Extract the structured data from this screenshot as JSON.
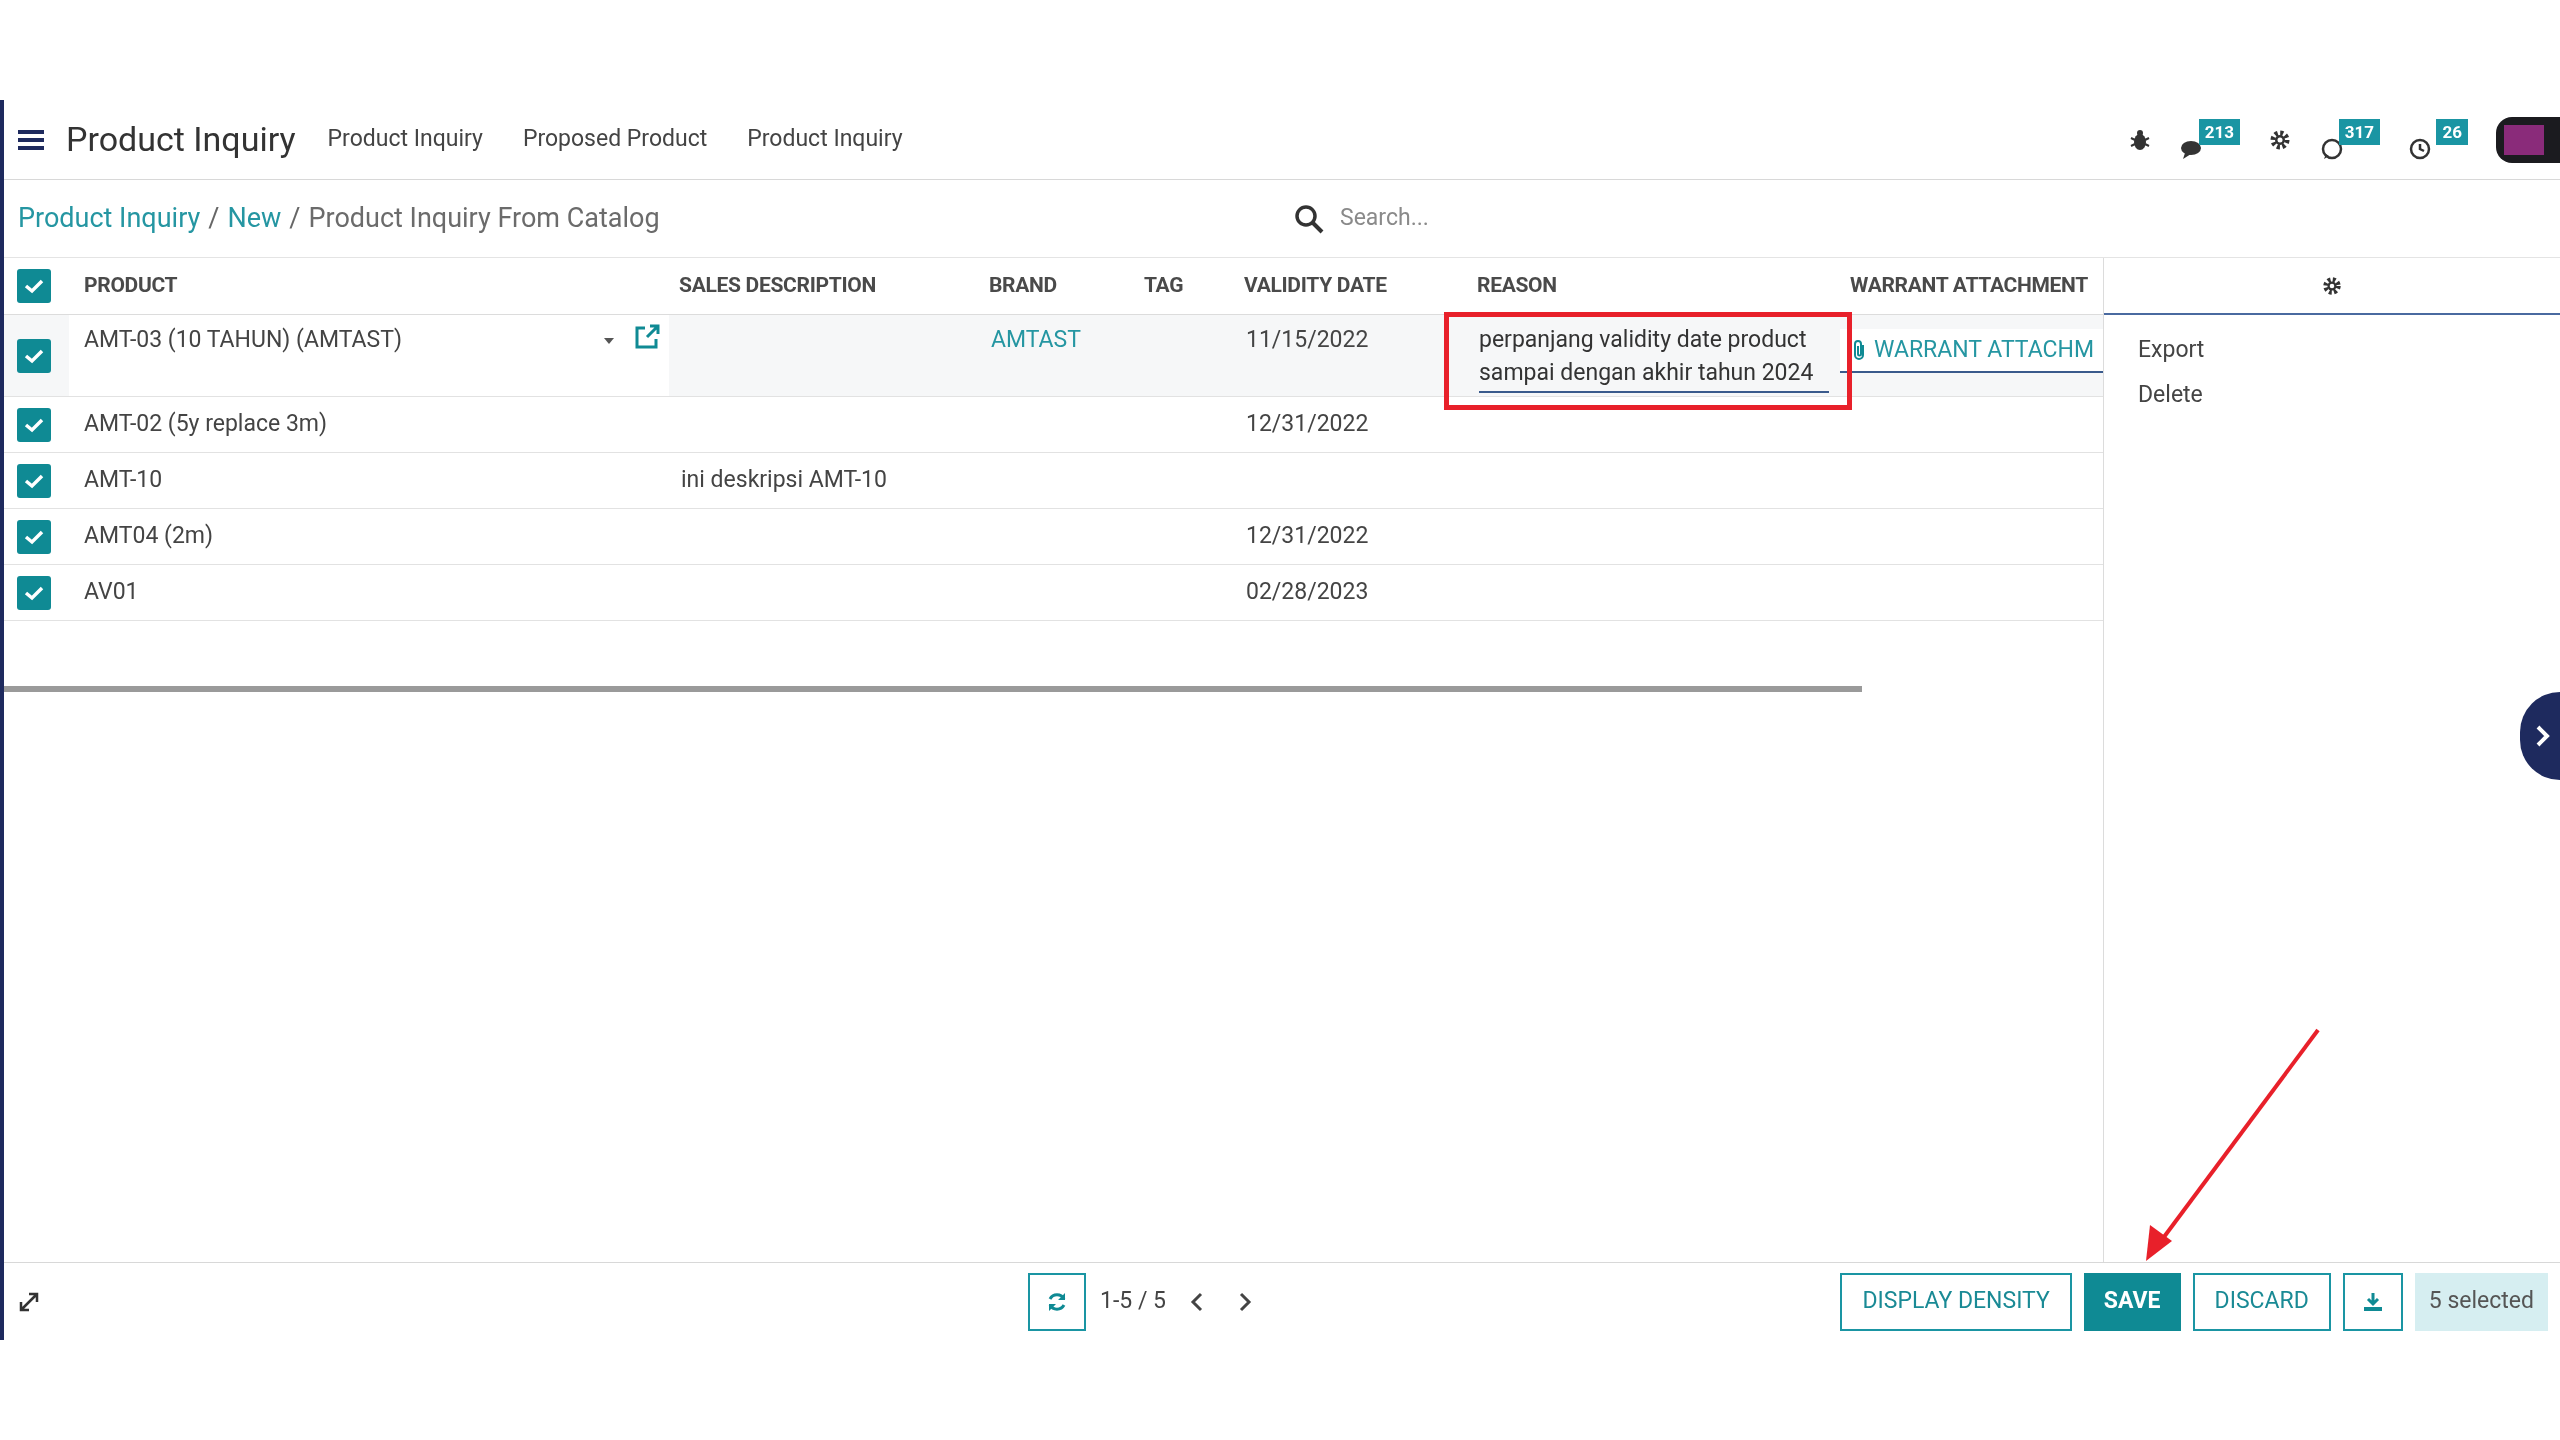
{
  "app": {
    "title": "Product Inquiry",
    "menu": [
      "Product Inquiry",
      "Proposed Product",
      "Product Inquiry"
    ]
  },
  "systray": [
    {
      "kind": "bug"
    },
    {
      "kind": "chat",
      "badge": "213"
    },
    {
      "kind": "gear"
    },
    {
      "kind": "phone-chat",
      "badge": "317"
    },
    {
      "kind": "clock",
      "badge": "26"
    }
  ],
  "breadcrumb": {
    "separator": "/",
    "items": [
      {
        "label": "Product Inquiry",
        "link": true
      },
      {
        "label": "New",
        "link": true
      },
      {
        "label": "Product Inquiry From Catalog",
        "link": false
      }
    ]
  },
  "search": {
    "placeholder": "Search..."
  },
  "table": {
    "all_checked": true,
    "columns": [
      "PRODUCT",
      "SALES DESCRIPTION",
      "BRAND",
      "TAG",
      "VALIDITY DATE",
      "REASON",
      "WARRANT ATTACHMENT"
    ],
    "rows": [
      {
        "checked": true,
        "editing": true,
        "product": "AMT-03 (10 TAHUN) (AMTAST)",
        "brand": "AMTAST",
        "validity_date": "11/15/2022",
        "reason": "perpanjang validity date product sampai dengan akhir tahun 2024",
        "warrant_attachment": "WARRANT ATTACHM"
      },
      {
        "checked": true,
        "editing": false,
        "product": "AMT-02 (5y replace 3m)",
        "validity_date": "12/31/2022"
      },
      {
        "checked": true,
        "editing": false,
        "product": "AMT-10",
        "sales_description": "ini deskripsi AMT-10"
      },
      {
        "checked": true,
        "editing": false,
        "product": "AMT04 (2m)",
        "validity_date": "12/31/2022"
      },
      {
        "checked": true,
        "editing": false,
        "product": "AV01",
        "validity_date": "02/28/2023"
      }
    ]
  },
  "side_actions": [
    "Export",
    "Delete"
  ],
  "pager": {
    "range": "1-5 / 5"
  },
  "buttons": [
    {
      "kind": "outline",
      "label": "DISPLAY DENSITY"
    },
    {
      "kind": "primary",
      "label": "SAVE"
    },
    {
      "kind": "outline",
      "label": "DISCARD"
    },
    {
      "kind": "download"
    }
  ],
  "selection": {
    "label": "5 selected"
  }
}
